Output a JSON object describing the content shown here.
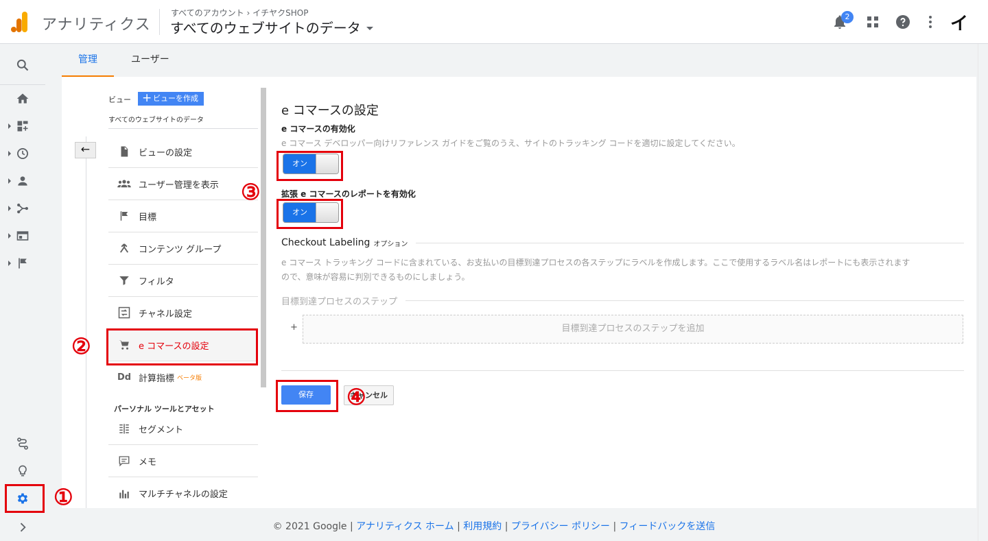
{
  "header": {
    "app_name": "アナリティクス",
    "breadcrumb": "すべてのアカウント › イチヤクSHOP",
    "view_selector": "すべてのウェブサイトのデータ",
    "notification_count": "2",
    "avatar_letter": "イ"
  },
  "tabs": [
    {
      "label": "管理",
      "active": true
    },
    {
      "label": "ユーザー",
      "active": false
    }
  ],
  "admin_nav": {
    "view_label": "ビュー",
    "create_view_button": "ビューを作成",
    "view_name": "すべてのウェブサイトのデータ",
    "back_icon": "←",
    "items": [
      {
        "label": "ビューの設定",
        "icon": "document-icon"
      },
      {
        "label": "ユーザー管理を表示",
        "icon": "people-icon"
      },
      {
        "label": "目標",
        "icon": "flag-icon"
      },
      {
        "label": "コンテンツ グループ",
        "icon": "content-grouping-icon"
      },
      {
        "label": "フィルタ",
        "icon": "filter-icon"
      },
      {
        "label": "チャネル設定",
        "icon": "channel-icon"
      },
      {
        "label": "e コマースの設定",
        "icon": "cart-icon",
        "active": true
      },
      {
        "label": "計算指標",
        "icon": "calculated-metrics-icon",
        "badge": "ベータ版"
      }
    ],
    "personal_section_label": "パーソナル ツールとアセット",
    "personal_items": [
      {
        "label": "セグメント",
        "icon": "segment-icon"
      },
      {
        "label": "メモ",
        "icon": "annotation-icon"
      },
      {
        "label": "マルチチャネルの設定",
        "icon": "bar-chart-icon"
      }
    ]
  },
  "ecommerce": {
    "title": "e コマースの設定",
    "enable_heading": "e コマースの有効化",
    "enable_description": "e コマース デベロッパー向けリファレンス ガイドをご覧のうえ、サイトのトラッキング コードを適切に設定してください。",
    "enable_toggle": "オン",
    "enhanced_heading": "拡張 e コマースのレポートを有効化",
    "enhanced_toggle": "オン",
    "checkout_heading": "Checkout Labeling",
    "checkout_optional": "オプション",
    "checkout_description_1": "e コマース トラッキング コードに含まれている、お支払いの目標到達プロセスの各ステップにラベルを作成します。ここで使用するラベル名はレポートにも表示されます",
    "checkout_description_2": "ので、意味が容易に判別できるものにしましょう。",
    "steps_heading": "目標到達プロセスのステップ",
    "add_step_plus": "+",
    "add_step_label": "目標到達プロセスのステップを追加",
    "save_button": "保存",
    "cancel_button": "キャンセル"
  },
  "annotations": {
    "n1": "①",
    "n2": "②",
    "n3": "③",
    "n4": "④",
    "box_color": "#e4000b"
  },
  "footer": {
    "copyright": "© 2021 Google",
    "sep": " | ",
    "links": [
      "アナリティクス ホーム",
      "利用規約",
      "プライバシー ポリシー",
      "フィードバックを送信"
    ]
  },
  "colors": {
    "accent": "#1a73e8",
    "tab_underline": "#f57c00",
    "logo_orange": "#f9ab00",
    "logo_dark_orange": "#e37400"
  }
}
